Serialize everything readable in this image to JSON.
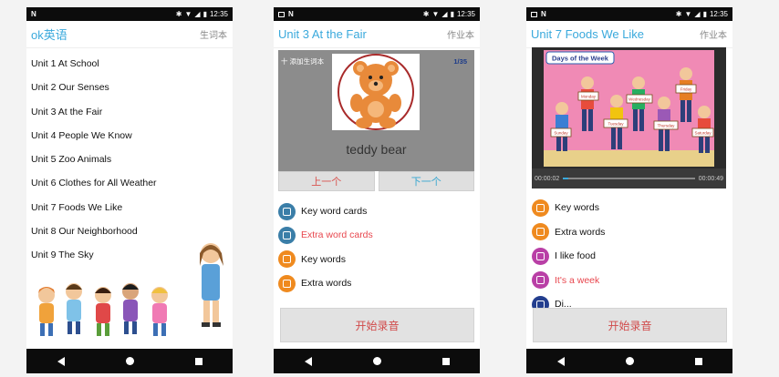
{
  "status": {
    "time": "12:35"
  },
  "screen1": {
    "title": "ok英语",
    "action": "生词本",
    "units": [
      "Unit 1 At School",
      "Unit 2 Our Senses",
      "Unit 3 At the Fair",
      "Unit 4 People We Know",
      "Unit 5 Zoo Animals",
      "Unit 6 Clothes for All Weather",
      "Unit 7 Foods We Like",
      "Unit 8 Our Neighborhood",
      "Unit 9 The Sky"
    ]
  },
  "screen2": {
    "title": "Unit 3 At the Fair",
    "action": "作业本",
    "add_word": "十 添加生词本",
    "counter": "1/35",
    "word": "teddy bear",
    "prev": "上一个",
    "next": "下一个",
    "menu": [
      {
        "label": "Key word cards",
        "icon": "card-icon",
        "color": "#3a7ea8"
      },
      {
        "label": "Extra word cards",
        "icon": "card-icon",
        "color": "#3a7ea8",
        "highlight": true
      },
      {
        "label": "Key words",
        "icon": "book-icon",
        "color": "#ef8a1f"
      },
      {
        "label": "Extra words",
        "icon": "book-icon",
        "color": "#ef8a1f"
      }
    ],
    "record": "开始录音"
  },
  "screen3": {
    "title": "Unit 7 Foods We Like",
    "action": "作业本",
    "video_caption": "Days of the Week",
    "sign_labels": [
      "Monday",
      "Friday",
      "Tuesday",
      "Wednesday",
      "Thursday",
      "Sunday",
      "Saturday"
    ],
    "time_current": "00:00:02",
    "time_total": "00:00:49",
    "progress": 0.04,
    "menu": [
      {
        "label": "Key words",
        "icon": "book-icon",
        "color": "#ef8a1f"
      },
      {
        "label": "Extra words",
        "icon": "book-icon",
        "color": "#ef8a1f"
      },
      {
        "label": "I like food",
        "icon": "music-icon",
        "color": "#b93fa6"
      },
      {
        "label": "It's a week",
        "icon": "music-icon",
        "color": "#b93fa6",
        "highlight": true
      },
      {
        "label": "Di...",
        "icon": "chat-icon",
        "color": "#233e8e"
      }
    ],
    "record": "开始录音"
  }
}
